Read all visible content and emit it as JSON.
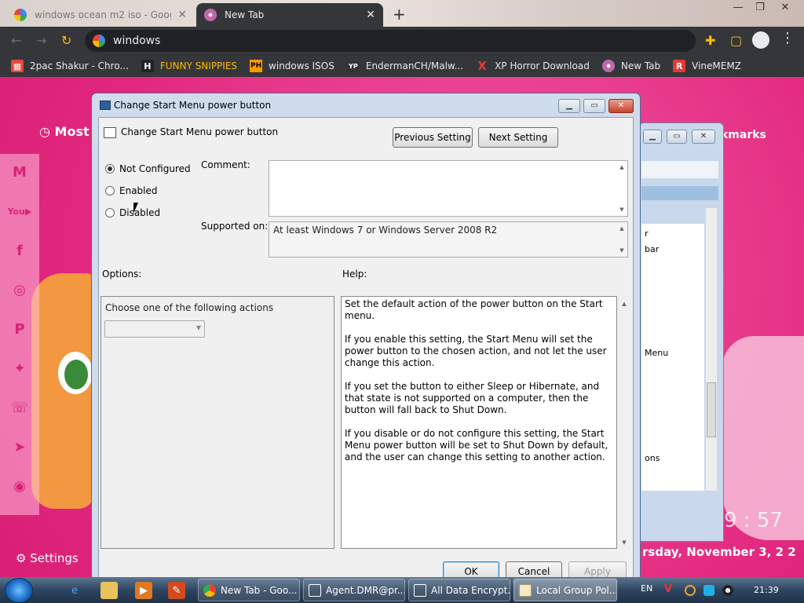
{
  "browser": {
    "tabs": [
      {
        "title": "windows ocean m2 iso - Google"
      },
      {
        "title": "New Tab"
      }
    ],
    "newtab_symbol": "+",
    "window_controls": {
      "minimize": "—",
      "maximize": "❐",
      "close": "✕"
    },
    "omnibox_value": "windows",
    "bookmarks": [
      {
        "label": "2pac Shakur - Chro...",
        "icon": "chrome-web-store-icon"
      },
      {
        "label": "FUNNY SNIPPIES",
        "icon": "h-badge-icon",
        "glyph": "H"
      },
      {
        "label": "windows ISOS",
        "icon": "ph-badge-icon",
        "glyph": "PH"
      },
      {
        "label": "EndermanCH/Malw...",
        "icon": "yp-badge-icon",
        "glyph": "YP"
      },
      {
        "label": "XP Horror Download",
        "icon": "x-badge-icon",
        "glyph": "X"
      },
      {
        "label": "New Tab",
        "icon": "new-tab-icon"
      },
      {
        "label": "VineMEMZ",
        "icon": "r-badge-icon",
        "glyph": "R"
      }
    ]
  },
  "ntp": {
    "most_visited": "Most V",
    "bookmarks_label": "kmarks",
    "settings_label": "Settings",
    "time_partial": "9 : 57",
    "date_partial": "rsday, November 3, 2  2",
    "sidebar_icons": [
      "gmail-icon",
      "youtube-icon",
      "facebook-icon",
      "instagram-icon",
      "pinterest-icon",
      "twitter-icon",
      "whatsapp-icon",
      "telegram-icon",
      "reddit-icon"
    ]
  },
  "bg_window": {
    "rows": [
      "r",
      "bar",
      "Menu",
      "ons"
    ]
  },
  "dialog": {
    "title": "Change Start Menu power button",
    "setting_name": "Change Start Menu power button",
    "previous_button": "Previous Setting",
    "next_button": "Next Setting",
    "options": [
      {
        "label": "Not Configured",
        "selected": true
      },
      {
        "label": "Enabled",
        "selected": false
      },
      {
        "label": "Disabled",
        "selected": false
      }
    ],
    "comment_label": "Comment:",
    "comment_value": "",
    "supported_label": "Supported on:",
    "supported_value": "At least Windows 7 or Windows Server 2008 R2",
    "options_label": "Options:",
    "help_label": "Help:",
    "options_instruction": "Choose one of the following actions",
    "action_dropdown_value": "",
    "help_paragraphs": [
      "Set the default action of the power button on the Start menu.",
      "If you enable this setting, the Start Menu will set the power button to the chosen action, and not let the user change this action.",
      "If you set the button to either Sleep or Hibernate, and that state is not supported on a computer, then the button will fall back to Shut Down.",
      "If you disable or do not configure this setting, the Start Menu power button will be set to Shut Down by default, and the user can change this setting to another action."
    ],
    "ok_button": "OK",
    "cancel_button": "Cancel",
    "apply_button": "Apply"
  },
  "taskbar": {
    "tasks": [
      {
        "label": "New Tab - Goo...",
        "icon": "chrome-icon"
      },
      {
        "label": "Agent.DMR@pr...",
        "icon": "app-window-icon"
      },
      {
        "label": "All Data Encrypt...",
        "icon": "app-window-icon"
      },
      {
        "label": "Local Group Pol...",
        "icon": "gpedit-icon",
        "active": true
      }
    ],
    "language": "EN",
    "clock": "21:39"
  }
}
